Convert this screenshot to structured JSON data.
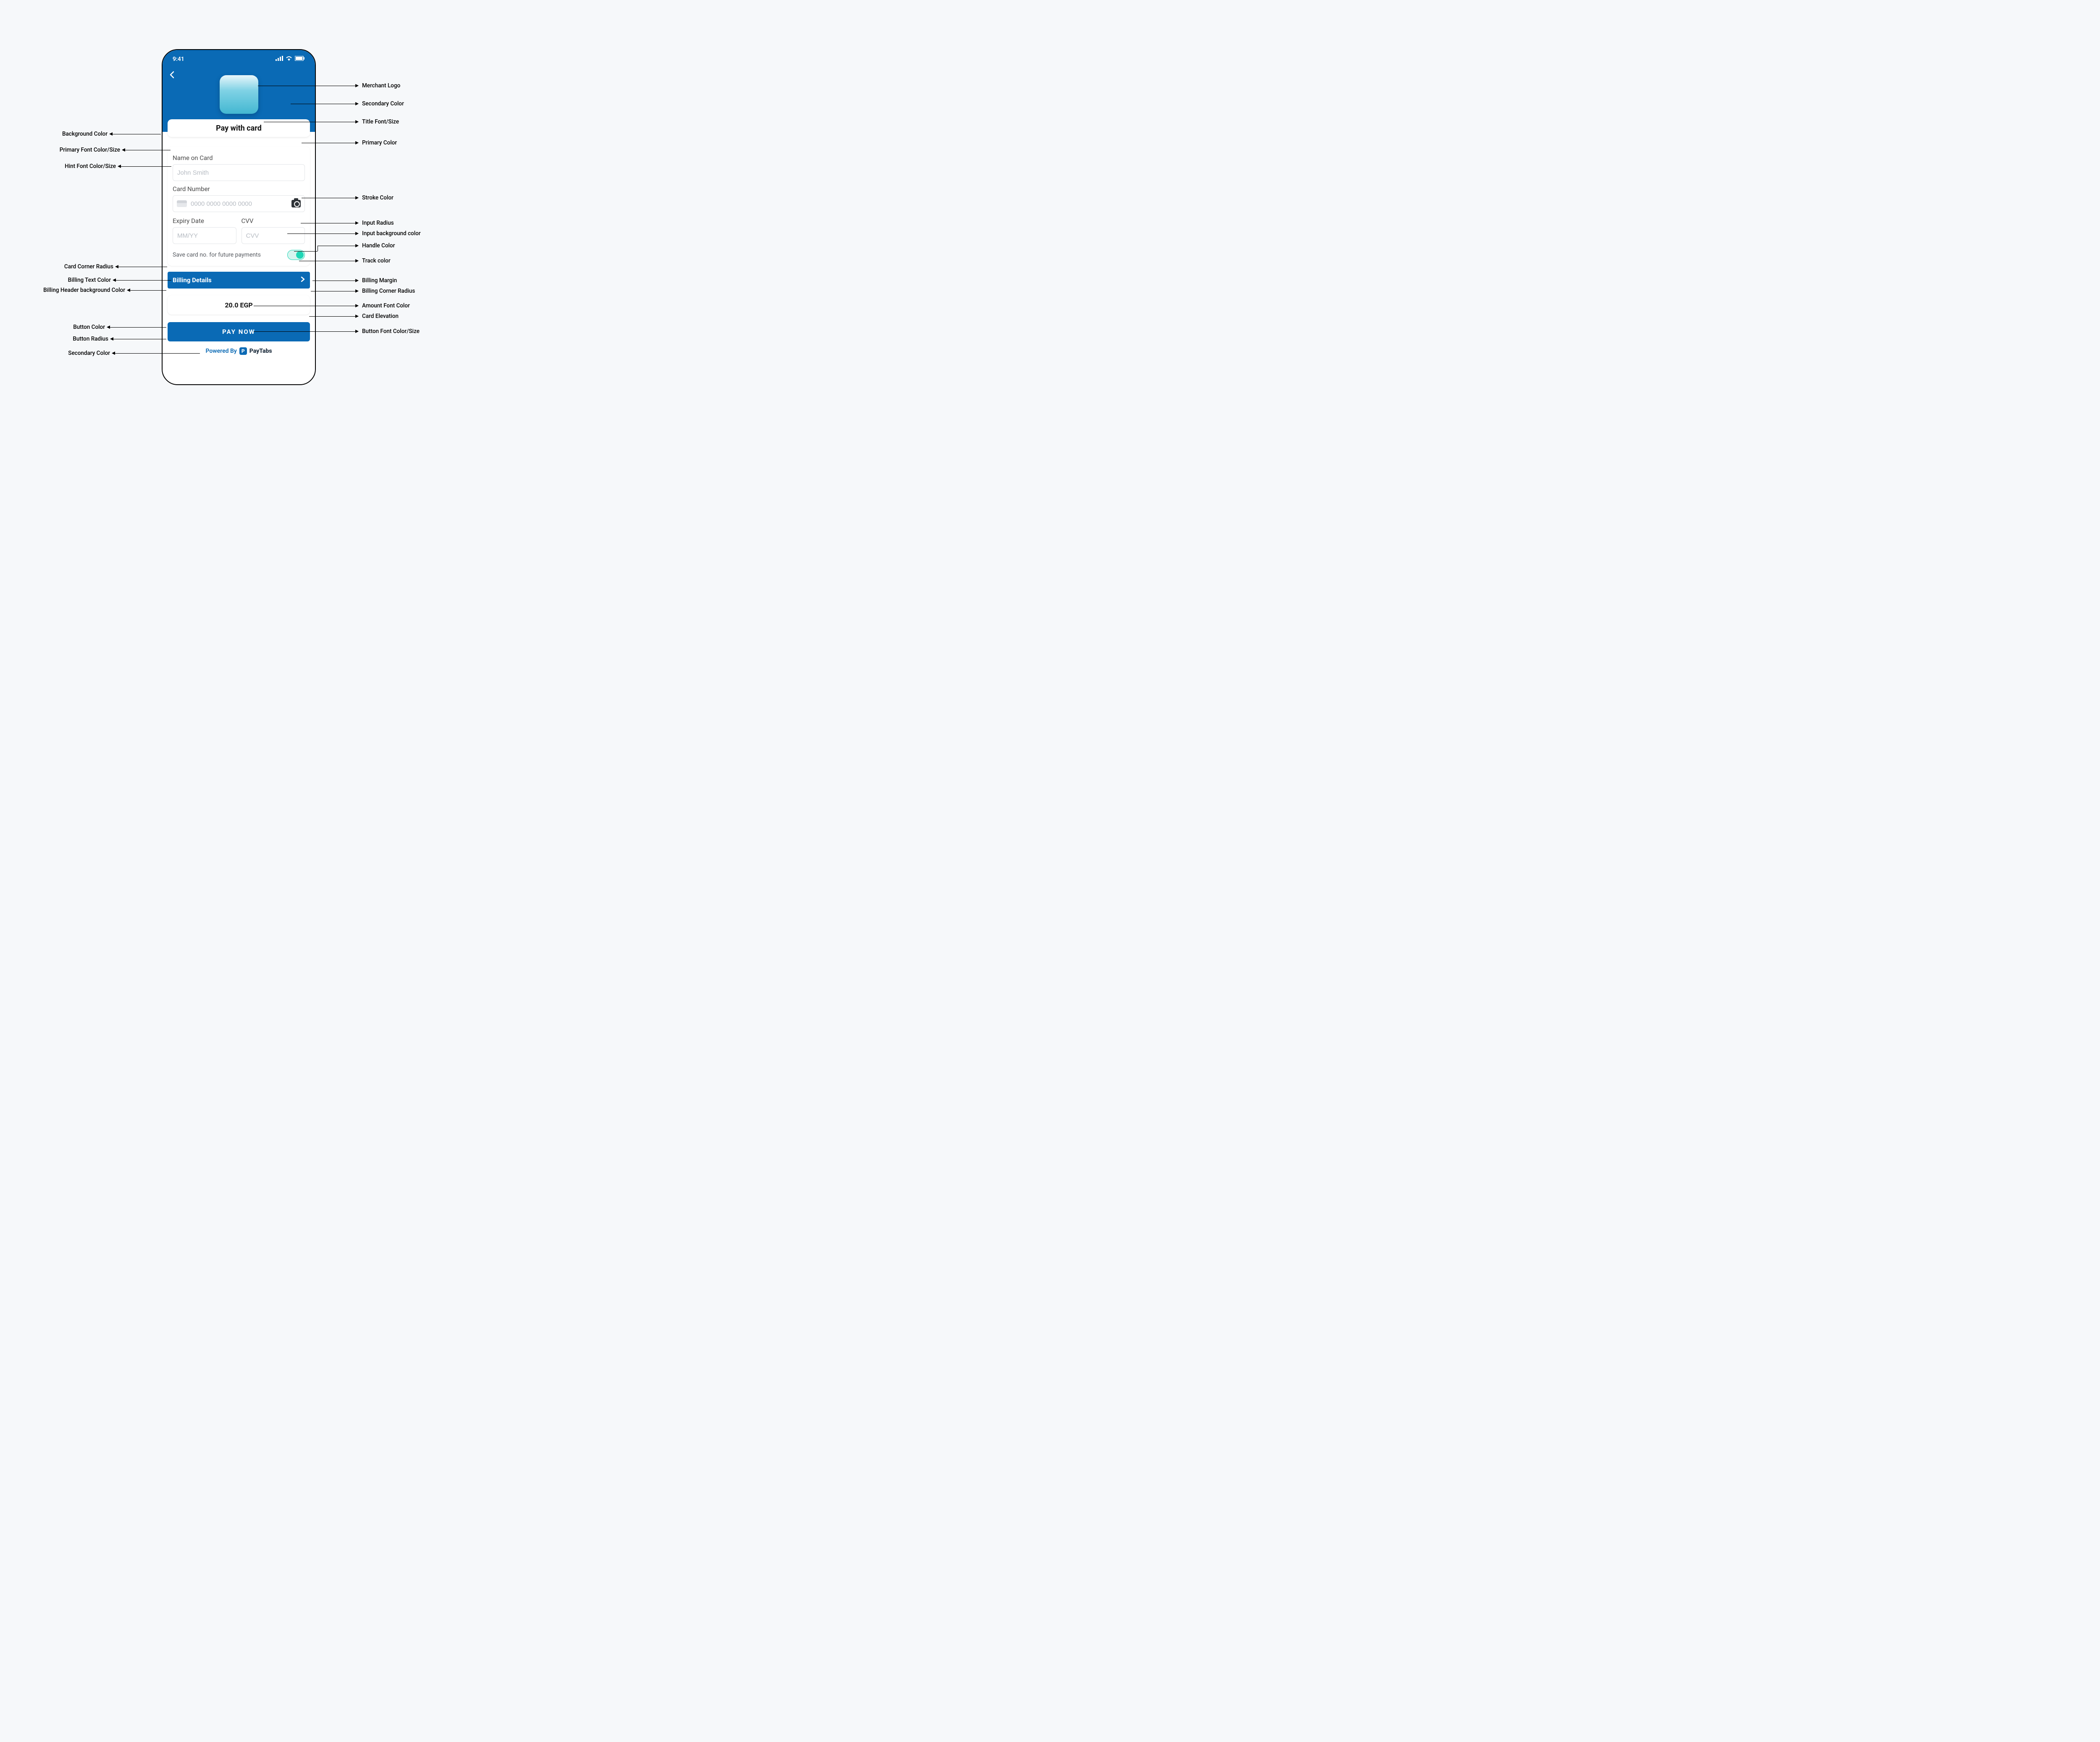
{
  "statusbar": {
    "time": "9:41"
  },
  "header": {
    "title": "Pay with card"
  },
  "form": {
    "name_label": "Name on Card",
    "name_placeholder": "John Smith",
    "card_label": "Card Number",
    "card_placeholder": "0000 0000 0000 0000",
    "expiry_label": "Expiry Date",
    "expiry_placeholder": "MM/YY",
    "cvv_label": "CVV",
    "cvv_placeholder": "CVV",
    "save_label": "Save card no. for future payments"
  },
  "billing": {
    "label": "Billing Details"
  },
  "amount": {
    "text": "20.0 EGP"
  },
  "button": {
    "label": "PAY NOW"
  },
  "footer": {
    "powered": "Powered By",
    "brand_badge": "P",
    "brand_text": "PayTabs"
  },
  "callouts": {
    "right": {
      "merchant_logo": "Merchant Logo",
      "secondary_color": "Secondary Color",
      "title_font": "Title Font/Size",
      "primary_color": "Primary Color",
      "stroke_color": "Stroke Color",
      "input_radius": "Input Radius",
      "input_bg": "Input background color",
      "handle_color": "Handle Color",
      "track_color": "Track color",
      "billing_margin": "Billing Margin",
      "billing_radius": "Billing Corner Radius",
      "amount_font": "Amount Font Color",
      "card_elev": "Card Elevation",
      "button_font": "Button Font Color/Size"
    },
    "left": {
      "bg_color": "Background Color",
      "primary_font": "Primary Font Color/Size",
      "hint_font": "Hint Font Color/Size",
      "card_radius": "Card Corner Radius",
      "billing_text": "Billing Text Color",
      "billing_header_bg": "Billing Header background Color",
      "button_color": "Button Color",
      "button_radius": "Button Radius",
      "secondary_color": "Secondary Color"
    }
  }
}
